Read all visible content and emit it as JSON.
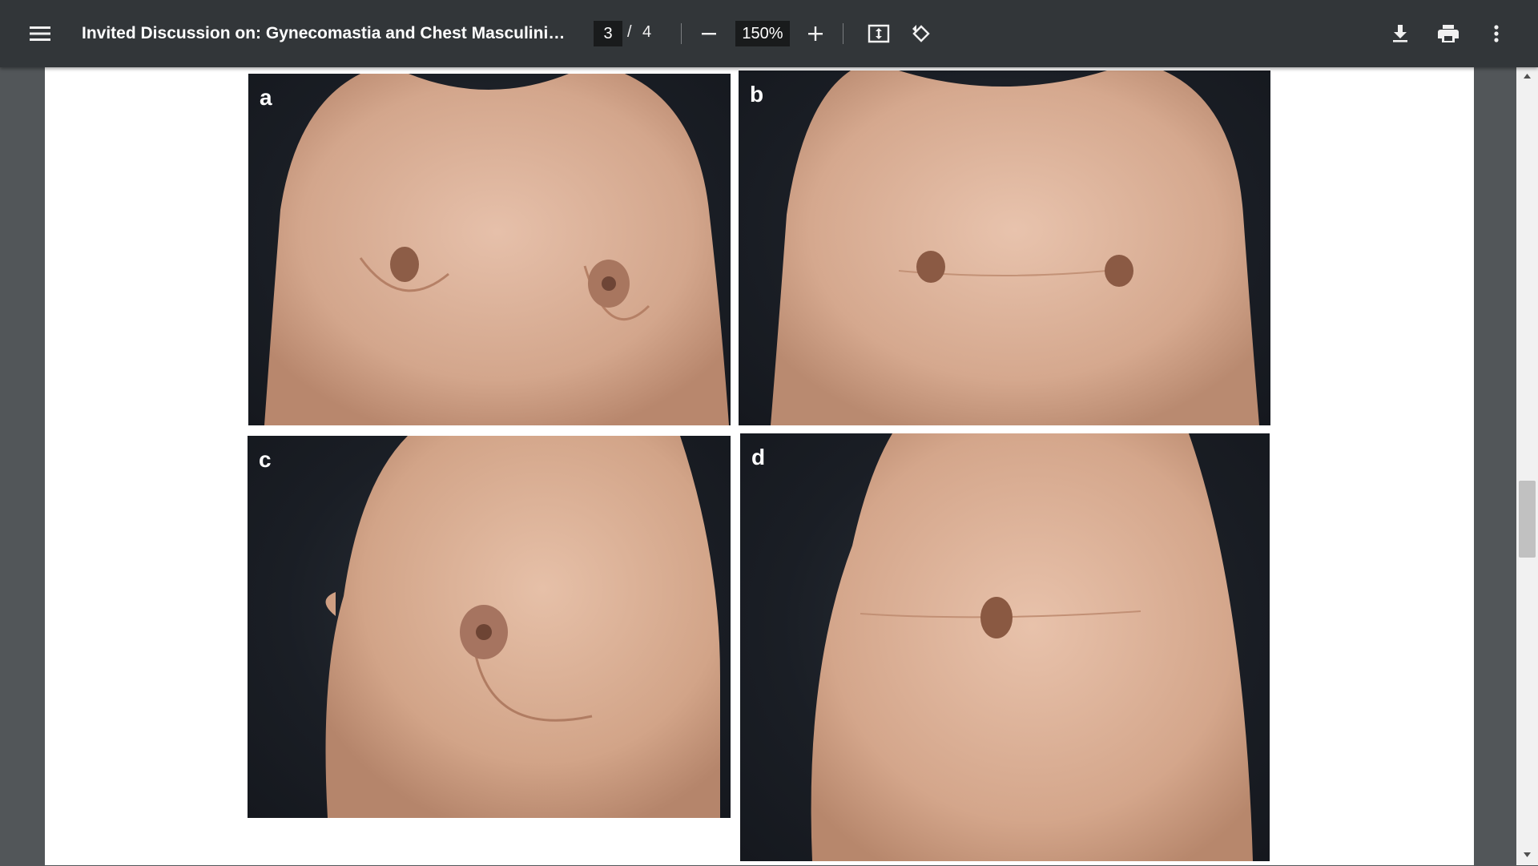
{
  "toolbar": {
    "title": "Invited Discussion on: Gynecomastia and Chest Masculinizatio…",
    "page_current": "3",
    "page_separator": "/",
    "page_total": "4",
    "zoom": "150%",
    "icons": {
      "menu": "hamburger-menu-icon",
      "zoom_out": "minus-icon",
      "zoom_in": "plus-icon",
      "fit": "fit-to-page-icon",
      "rotate": "rotate-counterclockwise-icon",
      "download": "download-icon",
      "print": "print-icon",
      "more": "more-vertical-icon"
    }
  },
  "figure": {
    "panels": [
      {
        "label": "a"
      },
      {
        "label": "b"
      },
      {
        "label": "c"
      },
      {
        "label": "d"
      }
    ]
  },
  "colors": {
    "toolbar_bg": "#323639",
    "viewer_bg": "#525659",
    "page_bg": "#ffffff",
    "photo_bg": "#1a1e25",
    "skin": "#d9ae95"
  }
}
